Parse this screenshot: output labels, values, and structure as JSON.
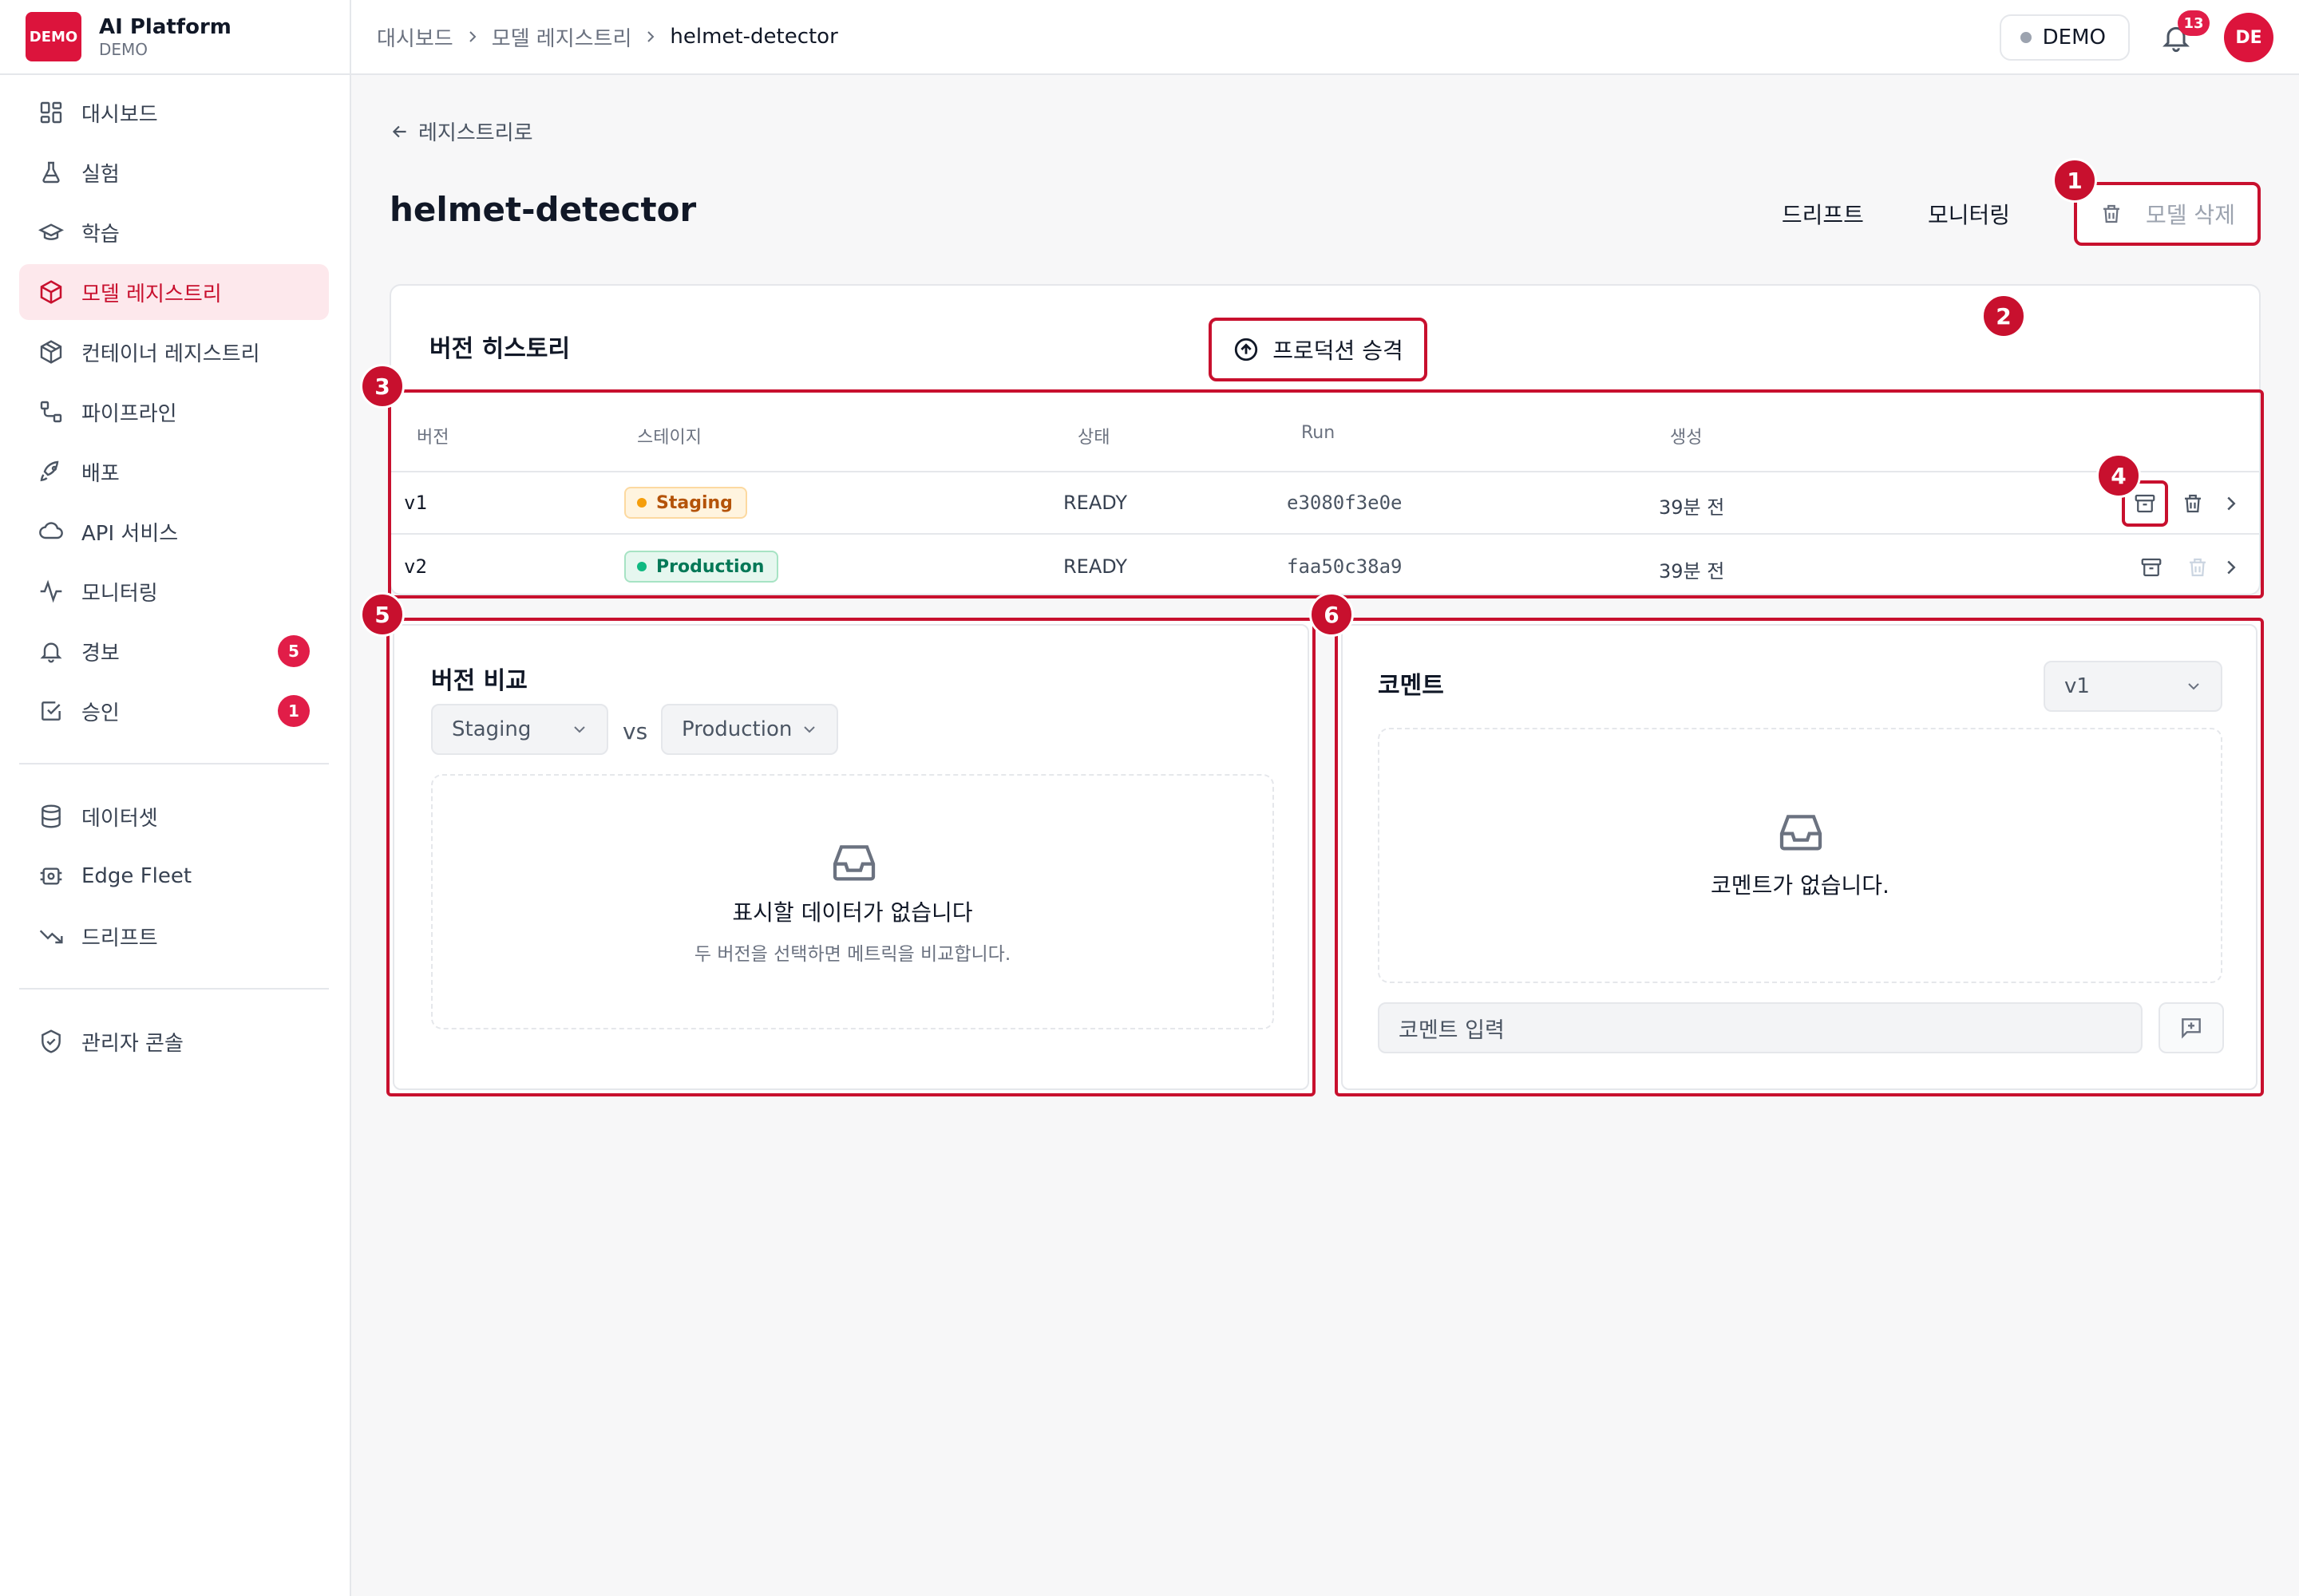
{
  "brand": {
    "logo": "DEMO",
    "name": "AI Platform",
    "sub": "DEMO"
  },
  "sidebar": {
    "items": [
      {
        "label": "대시보드",
        "icon": "dashboard-icon"
      },
      {
        "label": "실험",
        "icon": "flask-icon"
      },
      {
        "label": "학습",
        "icon": "graduation-cap-icon"
      },
      {
        "label": "모델 레지스트리",
        "icon": "cube-icon",
        "active": true
      },
      {
        "label": "컨테이너 레지스트리",
        "icon": "package-icon"
      },
      {
        "label": "파이프라인",
        "icon": "pipeline-icon"
      },
      {
        "label": "배포",
        "icon": "rocket-icon"
      },
      {
        "label": "API 서비스",
        "icon": "cloud-icon"
      },
      {
        "label": "모니터링",
        "icon": "activity-icon"
      },
      {
        "label": "경보",
        "icon": "bell-icon",
        "badge": "5"
      },
      {
        "label": "승인",
        "icon": "check-square-icon",
        "badge": "1"
      }
    ],
    "data_items": [
      {
        "label": "데이터셋",
        "icon": "database-icon"
      },
      {
        "label": "Edge Fleet",
        "icon": "edge-device-icon"
      },
      {
        "label": "드리프트",
        "icon": "trending-down-icon"
      }
    ],
    "admin_items": [
      {
        "label": "관리자 콘솔",
        "icon": "shield-icon"
      }
    ]
  },
  "topbar": {
    "breadcrumbs": [
      "대시보드",
      "모델 레지스트리",
      "helmet-detector"
    ],
    "env": "DEMO",
    "notification_count": "13",
    "avatar": "DE"
  },
  "page": {
    "back_label": "레지스트리로",
    "title": "helmet-detector",
    "actions": {
      "drift": "드리프트",
      "monitoring": "모니터링",
      "delete": "모델 삭제"
    }
  },
  "version_history": {
    "title": "버전 히스토리",
    "promote_label": "프로덕션 승격",
    "columns": [
      "버전",
      "스테이지",
      "상태",
      "Run",
      "생성"
    ],
    "rows": [
      {
        "version": "v1",
        "stage": "Staging",
        "status": "READY",
        "run": "e3080f3e0e",
        "created": "39분 전"
      },
      {
        "version": "v2",
        "stage": "Production",
        "status": "READY",
        "run": "faa50c38a9",
        "created": "39분 전"
      }
    ]
  },
  "compare": {
    "title": "버전 비교",
    "left_select": "Staging",
    "vs": "vs",
    "right_select": "Production",
    "empty_title": "표시할 데이터가 없습니다",
    "empty_sub": "두 버전을 선택하면 메트릭을 비교합니다."
  },
  "comments": {
    "title": "코멘트",
    "version_select": "v1",
    "empty_text": "코멘트가 없습니다.",
    "input_placeholder": "코멘트 입력"
  },
  "markers": [
    "1",
    "2",
    "3",
    "4",
    "5",
    "6"
  ],
  "colors": {
    "accent": "#c8102e",
    "brand": "#dc143c",
    "staging": "#b45309",
    "production": "#047857"
  }
}
